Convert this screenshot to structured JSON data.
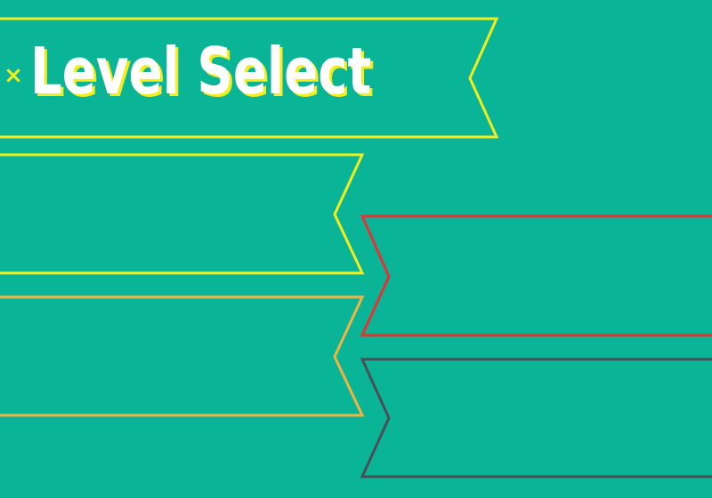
{
  "screen": {
    "title": "Level Select",
    "close_icon_glyph": "×"
  },
  "colors": {
    "background": "#0ab497",
    "title_text": "#ffffff",
    "title_shadow": "#f2ee1e",
    "close_icon": "#f2ee1e",
    "title_ribbon": "#f2ee1e",
    "level_1": "#f2ee1e",
    "level_2": "#e53333",
    "level_3": "#f2b341",
    "level_4": "#4a4f55"
  },
  "levels": [
    {
      "id": "level_1",
      "label": ""
    },
    {
      "id": "level_2",
      "label": ""
    },
    {
      "id": "level_3",
      "label": ""
    },
    {
      "id": "level_4",
      "label": ""
    }
  ]
}
